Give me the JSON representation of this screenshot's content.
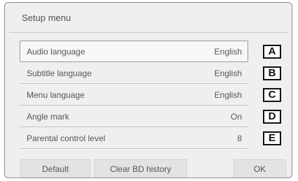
{
  "screen": {
    "title": "Setup menu"
  },
  "menu": {
    "items": [
      {
        "label": "Audio language",
        "value": "English"
      },
      {
        "label": "Subtitle language",
        "value": "English"
      },
      {
        "label": "Menu language",
        "value": "English"
      },
      {
        "label": "Angle mark",
        "value": "On"
      },
      {
        "label": "Parental control level",
        "value": "8"
      }
    ]
  },
  "callouts": [
    "A",
    "B",
    "C",
    "D",
    "E"
  ],
  "buttons": {
    "default": "Default",
    "clear_bd_history": "Clear BD history",
    "ok": "OK"
  },
  "colors": {
    "background": "#efefef",
    "text": "#555555",
    "callout_border": "#111111"
  }
}
